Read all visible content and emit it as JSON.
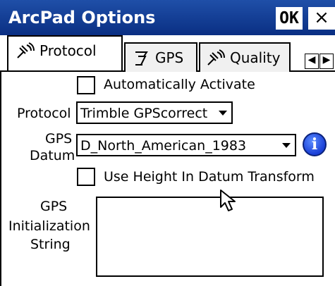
{
  "window": {
    "title": "ArcPad Options",
    "ok_label": "OK",
    "close_label": "×"
  },
  "tabs": [
    {
      "label": "Protocol",
      "icon": "satellite-icon",
      "active": true
    },
    {
      "label": "GPS",
      "icon": "gps-receiver-icon",
      "active": false
    },
    {
      "label": "Quality",
      "icon": "satellite-icon",
      "active": false
    }
  ],
  "tab_scroll": {
    "left": "◀",
    "right": "▶"
  },
  "form": {
    "auto_activate": {
      "label": "Automatically Activate",
      "checked": false
    },
    "protocol": {
      "label": "Protocol",
      "value": "Trimble GPScorrect"
    },
    "datum": {
      "label_line1": "GPS",
      "label_line2": "Datum",
      "value": "D_North_American_1983",
      "info_icon": "i"
    },
    "use_height": {
      "label": "Use Height In Datum Transform",
      "checked": false
    },
    "init_string": {
      "label_line1": "GPS",
      "label_line2": "Initialization",
      "label_line3": "String",
      "value": ""
    }
  },
  "colors": {
    "titlebar": "#0a2f83",
    "title_text": "#ffffff",
    "info_icon": "#1a3fd6"
  }
}
